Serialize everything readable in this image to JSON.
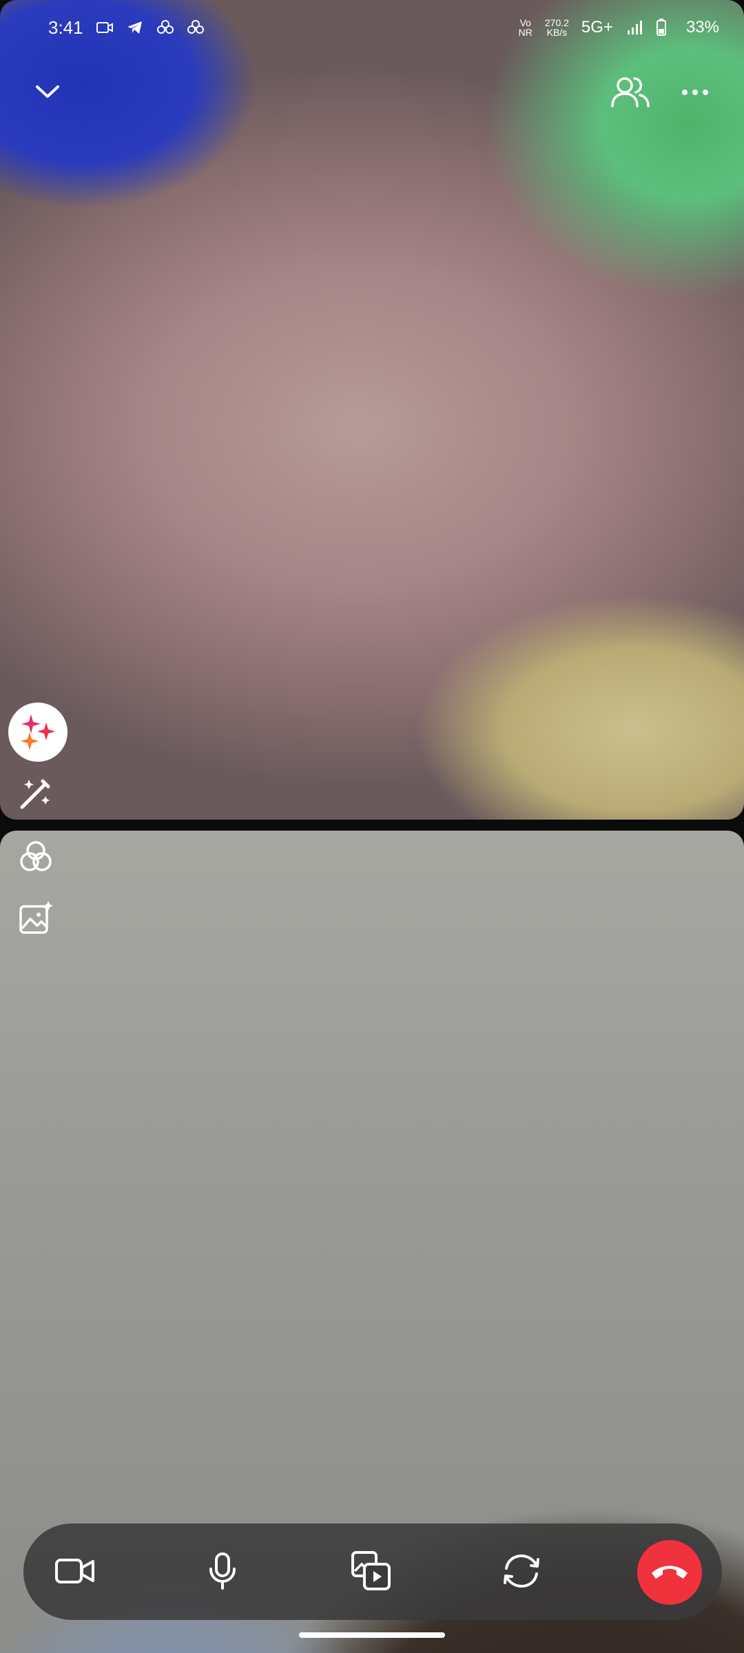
{
  "status_bar": {
    "time": "3:41",
    "vo_nr_top": "Vo",
    "vo_nr_bottom": "NR",
    "speed_top": "270.2",
    "speed_bottom": "KB/s",
    "network": "5G+",
    "battery": "33%"
  },
  "colors": {
    "end_call": "#f0323c",
    "call_bar": "#3a3a3a"
  },
  "icons": {
    "collapse": "chevron-down-icon",
    "participants": "people-icon",
    "more": "more-icon",
    "effects": "sparkle-icon",
    "magic": "magic-wand-icon",
    "filters": "filter-circles-icon",
    "background": "image-sparkle-icon",
    "video": "video-camera-icon",
    "mic": "microphone-icon",
    "share": "media-share-icon",
    "flip": "flip-camera-icon",
    "end_call": "end-call-icon"
  }
}
